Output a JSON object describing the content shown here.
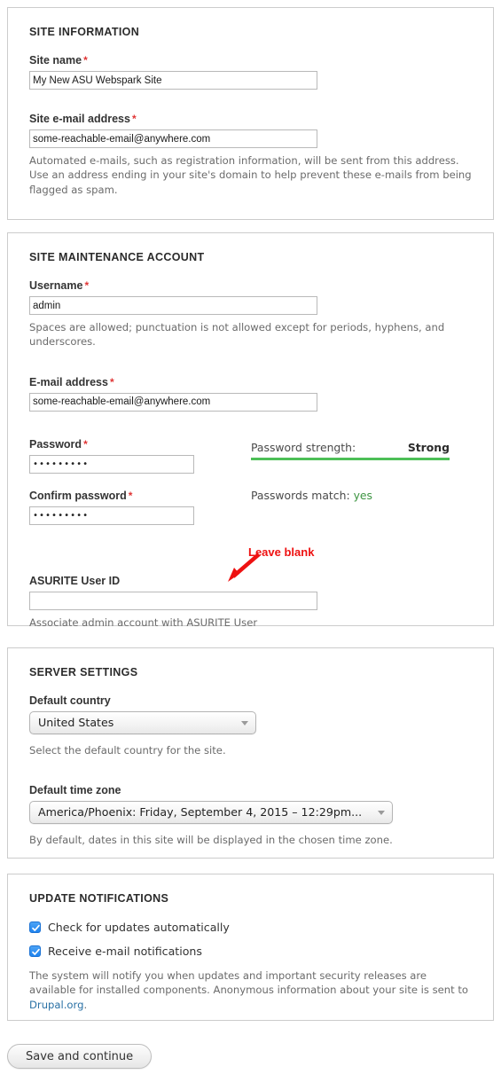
{
  "sections": {
    "site_information": {
      "legend": "SITE INFORMATION",
      "site_name": {
        "label": "Site name",
        "required_mark": "*",
        "value": "My New ASU Webspark Site"
      },
      "site_email": {
        "label": "Site e-mail address",
        "required_mark": "*",
        "value": "some-reachable-email@anywhere.com",
        "description": "Automated e-mails, such as registration information, will be sent from this address. Use an address ending in your site's domain to help prevent these e-mails from being flagged as spam."
      }
    },
    "site_maintenance_account": {
      "legend": "SITE MAINTENANCE ACCOUNT",
      "username": {
        "label": "Username",
        "required_mark": "*",
        "value": "admin",
        "description": "Spaces are allowed; punctuation is not allowed except for periods, hyphens, and underscores."
      },
      "email": {
        "label": "E-mail address",
        "required_mark": "*",
        "value": "some-reachable-email@anywhere.com"
      },
      "password": {
        "label": "Password",
        "required_mark": "*",
        "value": "•••••••••",
        "strength_label": "Password strength:",
        "strength_value": "Strong",
        "strength_percent": 100,
        "strength_color": "#4dbf57"
      },
      "confirm_password": {
        "label": "Confirm password",
        "required_mark": "*",
        "value": "•••••••••",
        "match_label": "Passwords match:",
        "match_value": "yes",
        "match_color": "#3d9442"
      },
      "asurite": {
        "label": "ASURITE User ID",
        "value": "",
        "description": "Associate admin account with ASURITE User"
      }
    },
    "server_settings": {
      "legend": "SERVER SETTINGS",
      "default_country": {
        "label": "Default country",
        "value": "United States",
        "description": "Select the default country for the site."
      },
      "default_time_zone": {
        "label": "Default time zone",
        "value": "America/Phoenix: Friday, September 4, 2015 – 12:29pm...",
        "description": "By default, dates in this site will be displayed in the chosen time zone."
      }
    },
    "update_notifications": {
      "legend": "UPDATE NOTIFICATIONS",
      "checkboxes": [
        {
          "label": "Check for updates automatically",
          "checked": true
        },
        {
          "label": "Receive e-mail notifications",
          "checked": true
        }
      ],
      "description_before_link": "The system will notify you when updates and important security releases are available for installed components. Anonymous information about your site is sent to ",
      "link_text": "Drupal.org",
      "description_after_link": "."
    }
  },
  "annotation": {
    "text": "Leave blank",
    "color": "#ee1111",
    "icon": "arrow-down-left-icon"
  },
  "actions": {
    "save_label": "Save and continue"
  }
}
